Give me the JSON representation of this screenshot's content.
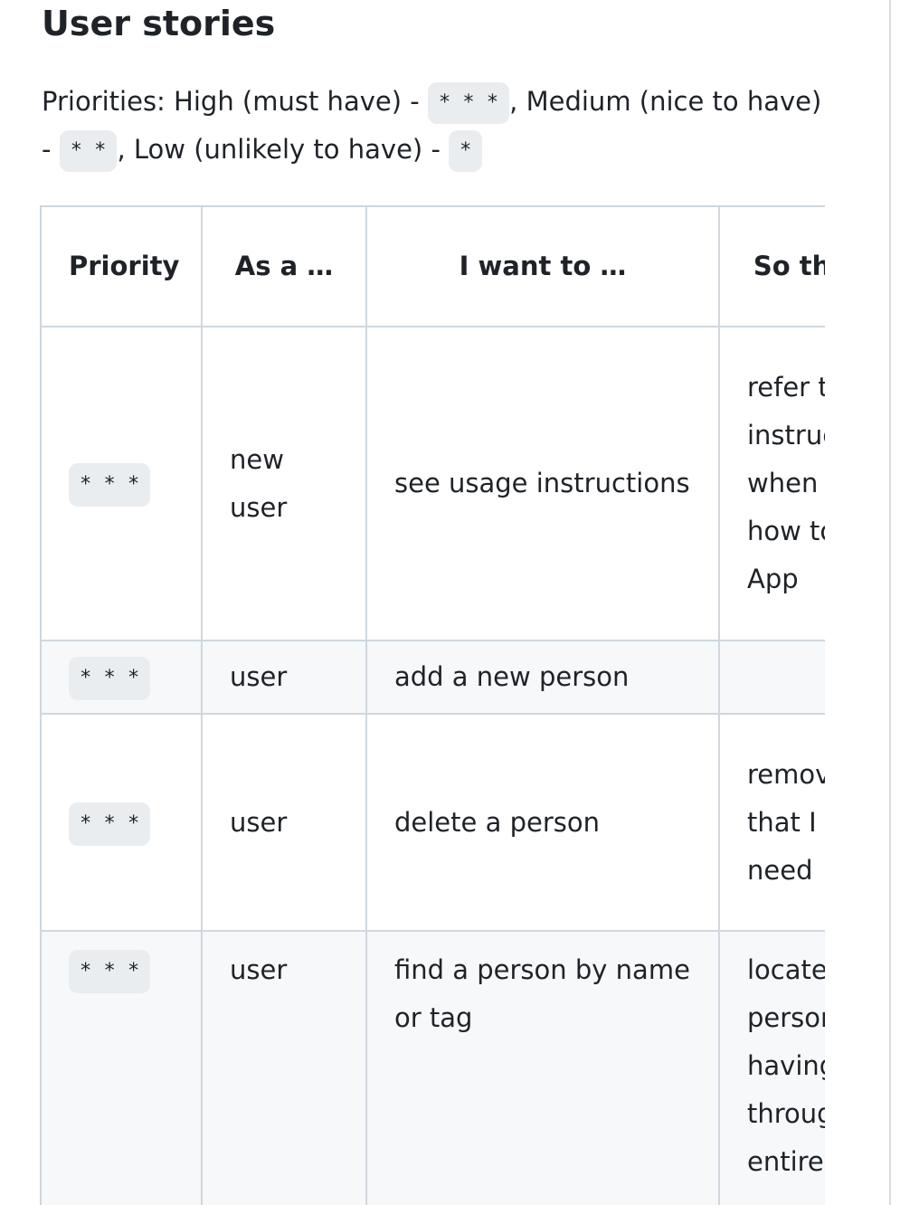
{
  "section": {
    "title": "User stories"
  },
  "priorities": {
    "intro": "Priorities: High (must have) - ",
    "high_code": "* * *",
    "medium_text": ", Medium (nice to have) - ",
    "medium_code": "* *",
    "low_text": ", Low (unlikely to have) - ",
    "low_code": "*"
  },
  "table": {
    "headers": [
      "Priority",
      "As a …",
      "I want to …",
      "So that I can…"
    ],
    "rows": [
      {
        "priority": "* * *",
        "as_a": "new user",
        "want": "see usage instructions",
        "so_that": "refer to instructions when I forget how to use the App"
      },
      {
        "priority": "* * *",
        "as_a": "user",
        "want": "add a new person",
        "so_that": ""
      },
      {
        "priority": "* * *",
        "as_a": "user",
        "want": "delete a person",
        "so_that": "remove entries that I no longer need"
      },
      {
        "priority": "* * *",
        "as_a": "user",
        "want": "find a person by name or tag",
        "so_that": "locate details of persons without having to go through the entire list"
      }
    ]
  }
}
